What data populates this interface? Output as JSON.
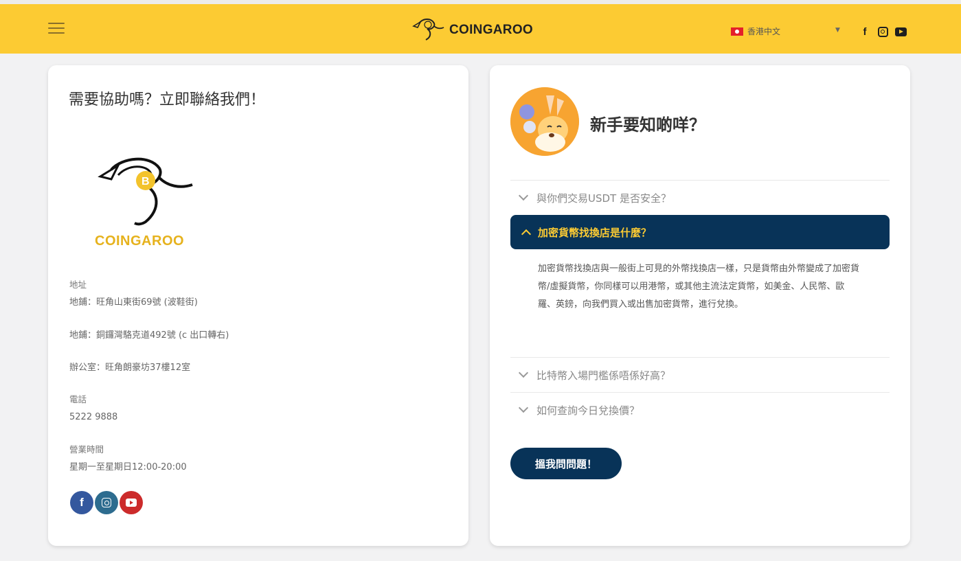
{
  "header": {
    "brand": "COINGAROO",
    "language": "香港中文",
    "colors": {
      "bar": "#fccb33"
    },
    "social_icons": [
      "facebook-icon",
      "instagram-icon",
      "youtube-icon"
    ]
  },
  "contact": {
    "title": "需要協助嗎？立即聯絡我們！",
    "logo_text": "COINGAROO",
    "address_label": "地址",
    "address_1": "地鋪：旺角山東街69號 (波鞋街)",
    "address_2": "地鋪：銅鑼灣駱克道492號 (c 出口轉右)",
    "office": "辦公室：旺角朗豪坊37樓12室",
    "phone_label": "電話",
    "phone": "5222 9888",
    "hours_label": "營業時間",
    "hours": "星期一至星期日12:00-20:00"
  },
  "faq": {
    "title": "新手要知啲咩？",
    "items": [
      {
        "question": "與你們交易USDT 是否安全？",
        "expanded": false
      },
      {
        "question": "加密貨幣找換店是什麼？",
        "expanded": true,
        "answer": "加密貨幣找換店與一般街上可見的外幣找換店一樣，只是貨幣由外幣變成了加密貨幣/虛擬貨幣，你同樣可以用港幣，或其他主流法定貨幣，如美金、人民幣、歐羅、英鎊，向我們買入或出售加密貨幣，進行兌換。"
      },
      {
        "question": "比特幣入場門檻係唔係好高？",
        "expanded": false
      },
      {
        "question": "如何查詢今日兌換價？",
        "expanded": false
      }
    ],
    "ask_button": "搵我問問題！",
    "colors": {
      "active_bg": "#083358",
      "active_text": "#fccb33"
    }
  }
}
